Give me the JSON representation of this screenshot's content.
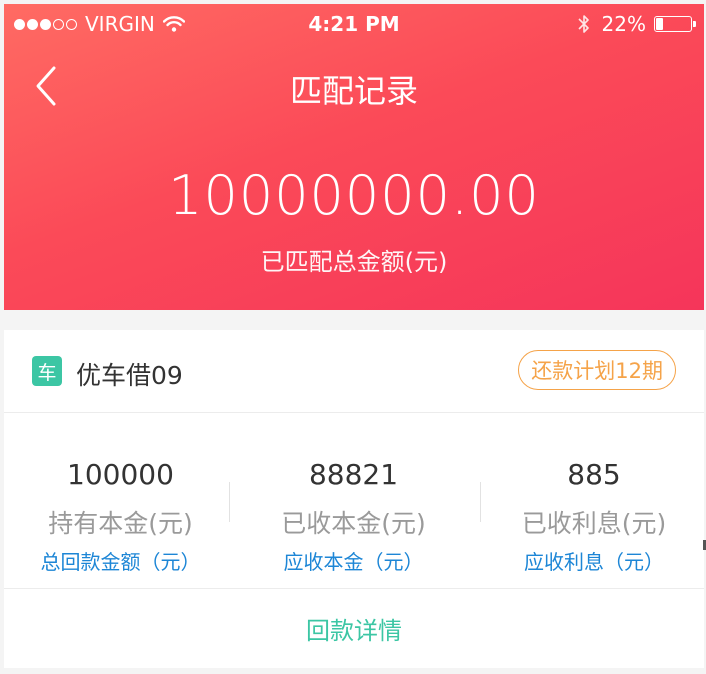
{
  "status_bar": {
    "carrier": "VIRGIN",
    "time": "4:21 PM",
    "battery_percent": "22%",
    "battery_level": 0.22,
    "signal_bars": [
      true,
      true,
      true,
      false,
      false
    ]
  },
  "nav": {
    "title": "匹配记录",
    "back_icon": "chevron-left-icon"
  },
  "summary": {
    "total_amount": "10000000.00",
    "total_label": "已匹配总金额(元)"
  },
  "product": {
    "badge": "车",
    "name": "优车借09",
    "plan_label": "还款计划12期"
  },
  "stats": [
    {
      "value": "100000",
      "label": "持有本金(元)",
      "sub": "总回款金额（元）"
    },
    {
      "value": "88821",
      "label": "已收本金(元)",
      "sub": "应收本金（元）"
    },
    {
      "value": "885",
      "label": "已收利息(元)",
      "sub": "应收利息（元）"
    }
  ],
  "detail_link": "回款详情",
  "colors": {
    "header_gradient_start": "#ff6b63",
    "header_gradient_end": "#f5355a",
    "accent_green": "#3cc6a4",
    "accent_orange": "#f5a349",
    "link_blue": "#1d86d6"
  }
}
